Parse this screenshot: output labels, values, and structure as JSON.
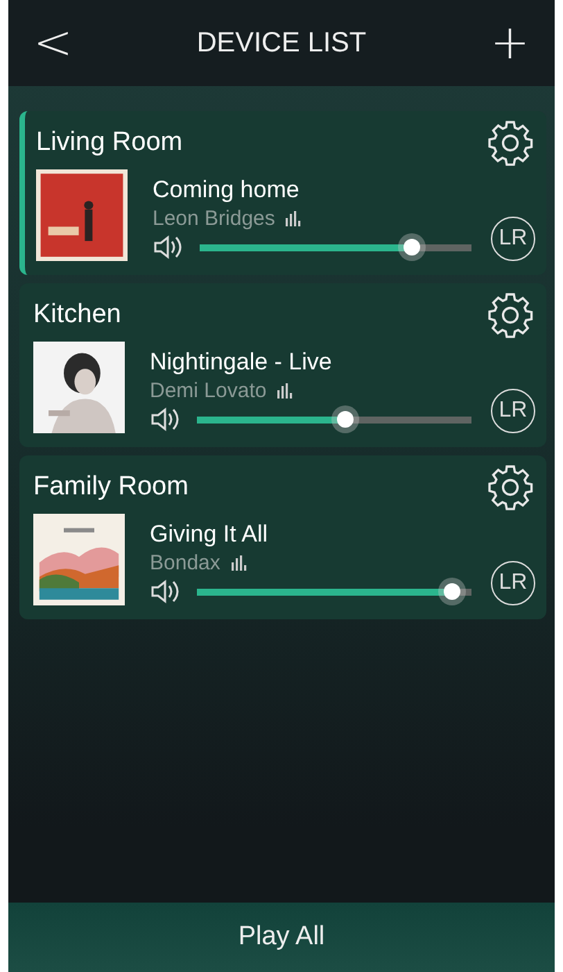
{
  "header": {
    "back": "<",
    "title": "DEVICE LIST",
    "add": "+"
  },
  "devices": [
    {
      "name": "Living Room",
      "selected": true,
      "song": "Coming home",
      "artist": "Leon Bridges",
      "level": 0.78,
      "channel": "LR"
    },
    {
      "name": "Kitchen",
      "selected": false,
      "song": "Nightingale - Live",
      "artist": "Demi Lovato",
      "level": 0.54,
      "channel": "LR"
    },
    {
      "name": "Family Room",
      "selected": false,
      "song": "Giving It All",
      "artist": "Bondax",
      "level": 0.93,
      "channel": "LR"
    }
  ],
  "footer": {
    "button": "Play All"
  }
}
